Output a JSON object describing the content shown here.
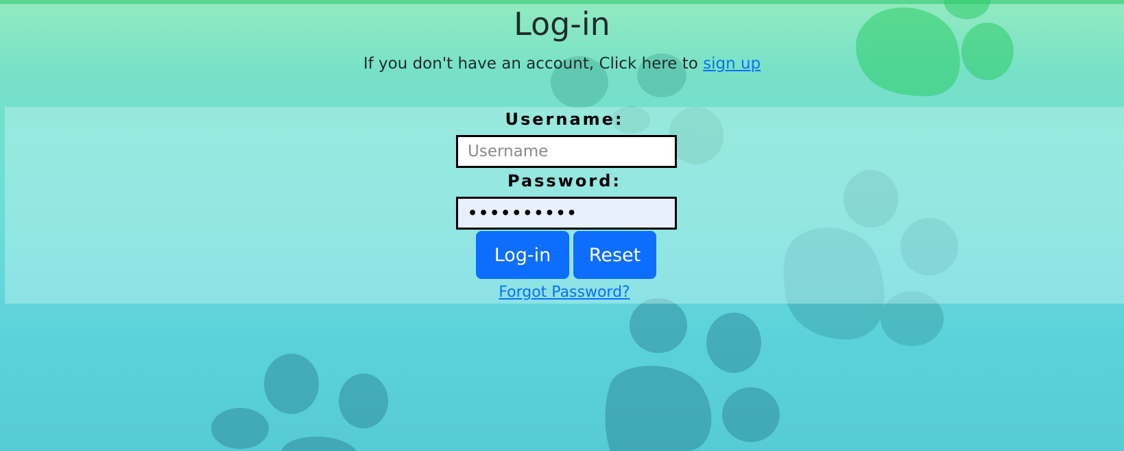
{
  "header": {
    "title": "Log-in",
    "signup_prompt": "If you don't have an account, Click here to ",
    "signup_link": "sign up"
  },
  "form": {
    "username_label": "Username:",
    "username_value": "",
    "username_placeholder": "Username",
    "password_label": "Password:",
    "password_value": "••••••••••",
    "login_button": "Log-in",
    "reset_button": "Reset",
    "forgot_link": "Forgot Password?"
  },
  "colors": {
    "accent": "#0d6efd",
    "background_top": "#93ebc0",
    "background_bottom": "#56cbd6",
    "paw_print": "#3a9ea8"
  },
  "background": {
    "decoration": "paw-prints"
  }
}
